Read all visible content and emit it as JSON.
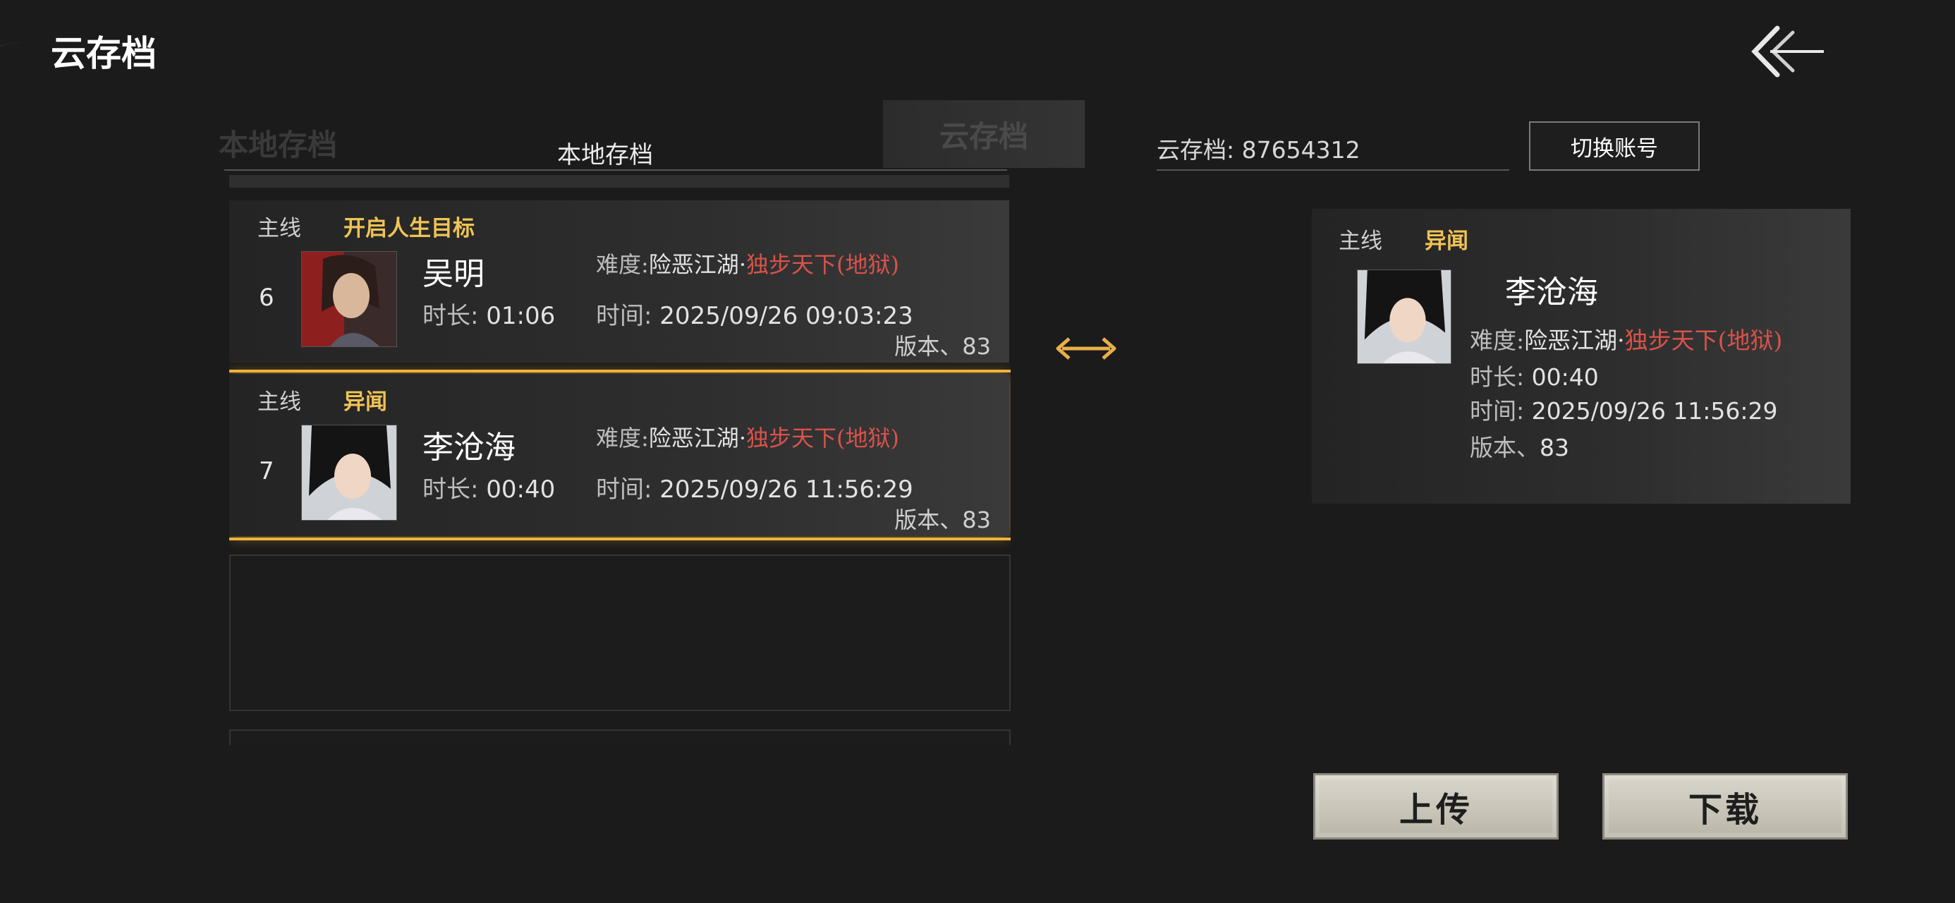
{
  "header": {
    "title": "云存档"
  },
  "tabs": {
    "local_ghost": "本地存档",
    "local": "本地存档",
    "cloud": "云存档"
  },
  "local_saves": [
    {
      "tag_main": "主线",
      "tag_quest": "开启人生目标",
      "slot": "6",
      "name": "吴明",
      "duration_label": "时长:",
      "duration": "01:06",
      "difficulty_label": "难度:",
      "difficulty": "险恶江湖",
      "sep": "·",
      "difficulty_hard": "独步天下(地狱)",
      "time_label": "时间:",
      "time": "2025/09/26 09:03:23",
      "version": "版本、83"
    },
    {
      "tag_main": "主线",
      "tag_quest": "异闻",
      "slot": "7",
      "name": "李沧海",
      "duration_label": "时长:",
      "duration": "00:40",
      "difficulty_label": "难度:",
      "difficulty": "险恶江湖",
      "sep": "·",
      "difficulty_hard": "独步天下(地狱)",
      "time_label": "时间:",
      "time": "2025/09/26 11:56:29",
      "version": "版本、83"
    }
  ],
  "cloud": {
    "account": "云存档: 87654312",
    "switch_label": "切换账号",
    "card": {
      "tag_main": "主线",
      "tag_quest": "异闻",
      "name": "李沧海",
      "difficulty_label": "难度:",
      "difficulty": "险恶江湖",
      "sep": "·",
      "difficulty_hard": "独步天下(地狱)",
      "duration_label": "时长:",
      "duration": "00:40",
      "time_label": "时间:",
      "time": "2025/09/26 11:56:29",
      "version_label": "版本、",
      "version": "83"
    }
  },
  "actions": {
    "upload": "上传",
    "download": "下载"
  },
  "icons": {
    "back": "back-arrow-icon",
    "swap": "swap-arrows-icon"
  },
  "colors": {
    "accent": "#f0b23d",
    "hard": "#d9524a",
    "quest": "#f0c454"
  }
}
